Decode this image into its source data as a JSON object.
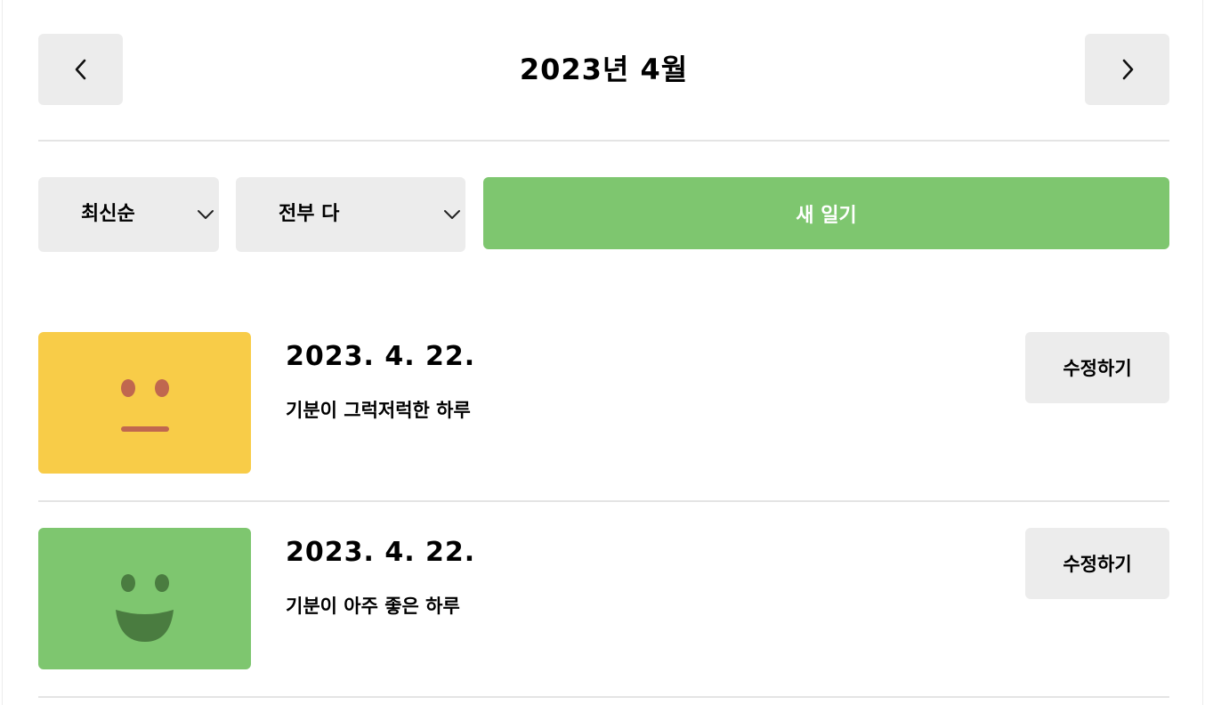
{
  "header": {
    "title": "2023년 4월",
    "prev_label": "<",
    "next_label": ">"
  },
  "controls": {
    "sort_selected": "최신순",
    "filter_selected": "전부 다",
    "new_button_label": "새 일기"
  },
  "colors": {
    "accent_green": "#7ec66f",
    "emotion_neutral": "#f8cc48",
    "emotion_good": "#7ec66f",
    "button_gray": "#ececec"
  },
  "entries": [
    {
      "date": "2023. 4. 22.",
      "content": "기분이 그럭저럭한 하루",
      "emotion_icon": "neutral-face-icon",
      "edit_label": "수정하기"
    },
    {
      "date": "2023. 4. 22.",
      "content": "기분이 아주 좋은 하루",
      "emotion_icon": "smile-face-icon",
      "edit_label": "수정하기"
    }
  ]
}
